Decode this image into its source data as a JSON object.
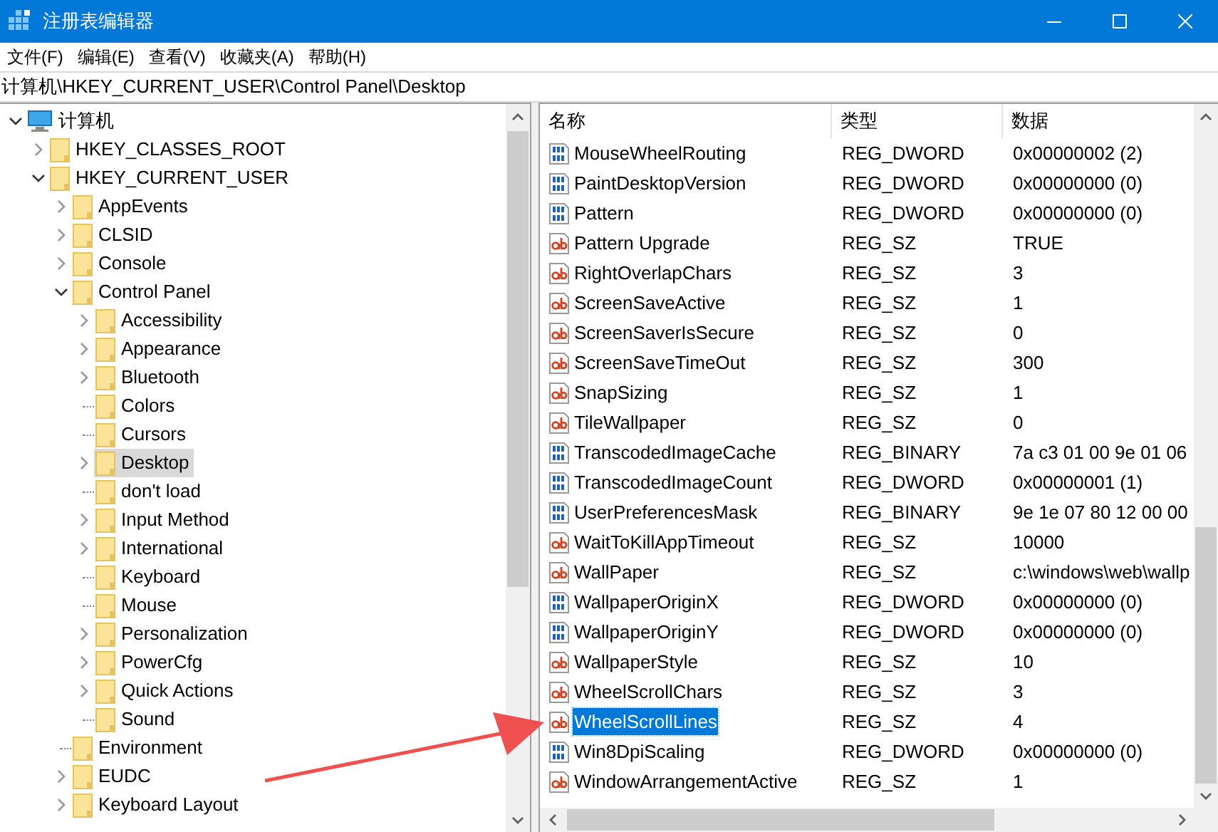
{
  "window": {
    "title": "注册表编辑器"
  },
  "menu": [
    {
      "label": "文件(F)"
    },
    {
      "label": "编辑(E)"
    },
    {
      "label": "查看(V)"
    },
    {
      "label": "收藏夹(A)"
    },
    {
      "label": "帮助(H)"
    }
  ],
  "address": "计算机\\HKEY_CURRENT_USER\\Control Panel\\Desktop",
  "tree": [
    {
      "label": "计算机",
      "kind": "computer",
      "expanded": true,
      "selected": false,
      "children": [
        {
          "label": "HKEY_CLASSES_ROOT",
          "kind": "folder",
          "expanded": false,
          "selected": false
        },
        {
          "label": "HKEY_CURRENT_USER",
          "kind": "folder",
          "expanded": true,
          "selected": false,
          "children": [
            {
              "label": "AppEvents",
              "kind": "folder",
              "expanded": false,
              "selected": false
            },
            {
              "label": "CLSID",
              "kind": "folder",
              "expanded": false,
              "selected": false
            },
            {
              "label": "Console",
              "kind": "folder",
              "expanded": false,
              "selected": false
            },
            {
              "label": "Control Panel",
              "kind": "folder",
              "expanded": true,
              "selected": false,
              "children": [
                {
                  "label": "Accessibility",
                  "kind": "folder",
                  "expanded": false,
                  "selected": false
                },
                {
                  "label": "Appearance",
                  "kind": "folder",
                  "expanded": false,
                  "selected": false
                },
                {
                  "label": "Bluetooth",
                  "kind": "folder",
                  "expanded": false,
                  "selected": false
                },
                {
                  "label": "Colors",
                  "kind": "leaf",
                  "expanded": false,
                  "selected": false
                },
                {
                  "label": "Cursors",
                  "kind": "leaf",
                  "expanded": false,
                  "selected": false
                },
                {
                  "label": "Desktop",
                  "kind": "folder",
                  "expanded": false,
                  "selected": true
                },
                {
                  "label": "don't load",
                  "kind": "leaf",
                  "expanded": false,
                  "selected": false
                },
                {
                  "label": "Input Method",
                  "kind": "folder",
                  "expanded": false,
                  "selected": false
                },
                {
                  "label": "International",
                  "kind": "folder",
                  "expanded": false,
                  "selected": false
                },
                {
                  "label": "Keyboard",
                  "kind": "leaf",
                  "expanded": false,
                  "selected": false
                },
                {
                  "label": "Mouse",
                  "kind": "leaf",
                  "expanded": false,
                  "selected": false
                },
                {
                  "label": "Personalization",
                  "kind": "folder",
                  "expanded": false,
                  "selected": false
                },
                {
                  "label": "PowerCfg",
                  "kind": "folder",
                  "expanded": false,
                  "selected": false
                },
                {
                  "label": "Quick Actions",
                  "kind": "folder",
                  "expanded": false,
                  "selected": false
                },
                {
                  "label": "Sound",
                  "kind": "leaf",
                  "expanded": false,
                  "selected": false
                }
              ]
            },
            {
              "label": "Environment",
              "kind": "leaf",
              "expanded": false,
              "selected": false
            },
            {
              "label": "EUDC",
              "kind": "folder",
              "expanded": false,
              "selected": false
            },
            {
              "label": "Keyboard Layout",
              "kind": "folder",
              "expanded": false,
              "selected": false
            }
          ]
        }
      ]
    }
  ],
  "table": {
    "columns": [
      "名称",
      "类型",
      "数据"
    ],
    "rows": [
      {
        "name": "MouseWheelRouting",
        "kind": "binary",
        "type": "REG_DWORD",
        "data": "0x00000002 (2)",
        "selected": false
      },
      {
        "name": "PaintDesktopVersion",
        "kind": "binary",
        "type": "REG_DWORD",
        "data": "0x00000000 (0)",
        "selected": false
      },
      {
        "name": "Pattern",
        "kind": "binary",
        "type": "REG_DWORD",
        "data": "0x00000000 (0)",
        "selected": false
      },
      {
        "name": "Pattern Upgrade",
        "kind": "string",
        "type": "REG_SZ",
        "data": "TRUE",
        "selected": false
      },
      {
        "name": "RightOverlapChars",
        "kind": "string",
        "type": "REG_SZ",
        "data": "3",
        "selected": false
      },
      {
        "name": "ScreenSaveActive",
        "kind": "string",
        "type": "REG_SZ",
        "data": "1",
        "selected": false
      },
      {
        "name": "ScreenSaverIsSecure",
        "kind": "string",
        "type": "REG_SZ",
        "data": "0",
        "selected": false
      },
      {
        "name": "ScreenSaveTimeOut",
        "kind": "string",
        "type": "REG_SZ",
        "data": "300",
        "selected": false
      },
      {
        "name": "SnapSizing",
        "kind": "string",
        "type": "REG_SZ",
        "data": "1",
        "selected": false
      },
      {
        "name": "TileWallpaper",
        "kind": "string",
        "type": "REG_SZ",
        "data": "0",
        "selected": false
      },
      {
        "name": "TranscodedImageCache",
        "kind": "binary",
        "type": "REG_BINARY",
        "data": "7a c3 01 00 9e 01 06",
        "selected": false
      },
      {
        "name": "TranscodedImageCount",
        "kind": "binary",
        "type": "REG_DWORD",
        "data": "0x00000001 (1)",
        "selected": false
      },
      {
        "name": "UserPreferencesMask",
        "kind": "binary",
        "type": "REG_BINARY",
        "data": "9e 1e 07 80 12 00 00",
        "selected": false
      },
      {
        "name": "WaitToKillAppTimeout",
        "kind": "string",
        "type": "REG_SZ",
        "data": "10000",
        "selected": false
      },
      {
        "name": "WallPaper",
        "kind": "string",
        "type": "REG_SZ",
        "data": "c:\\windows\\web\\wallp",
        "selected": false
      },
      {
        "name": "WallpaperOriginX",
        "kind": "binary",
        "type": "REG_DWORD",
        "data": "0x00000000 (0)",
        "selected": false
      },
      {
        "name": "WallpaperOriginY",
        "kind": "binary",
        "type": "REG_DWORD",
        "data": "0x00000000 (0)",
        "selected": false
      },
      {
        "name": "WallpaperStyle",
        "kind": "string",
        "type": "REG_SZ",
        "data": "10",
        "selected": false
      },
      {
        "name": "WheelScrollChars",
        "kind": "string",
        "type": "REG_SZ",
        "data": "3",
        "selected": false
      },
      {
        "name": "WheelScrollLines",
        "kind": "string",
        "type": "REG_SZ",
        "data": "4",
        "selected": true
      },
      {
        "name": "Win8DpiScaling",
        "kind": "binary",
        "type": "REG_DWORD",
        "data": "0x00000000 (0)",
        "selected": false
      },
      {
        "name": "WindowArrangementActive",
        "kind": "string",
        "type": "REG_SZ",
        "data": "1",
        "selected": false
      }
    ]
  }
}
